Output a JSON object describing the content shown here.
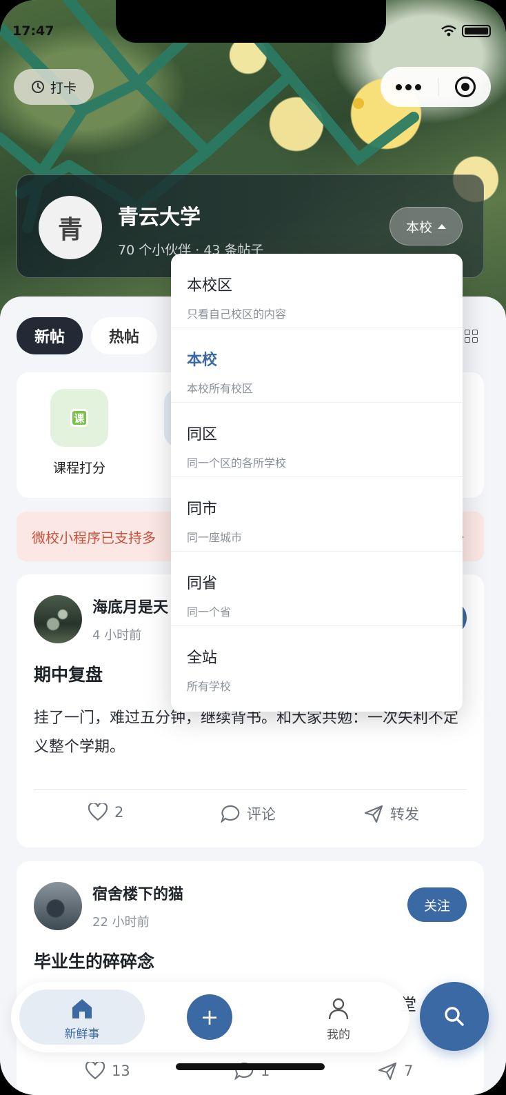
{
  "status_bar": {
    "time": "17:47"
  },
  "header": {
    "checkin_label": "打卡",
    "school": {
      "avatar_char": "青",
      "name": "青云大学",
      "stats": "70 个小伙伴 · 43 条帖子",
      "scope_button": "本校"
    }
  },
  "tabs": [
    {
      "label": "新帖",
      "active": true
    },
    {
      "label": "热帖",
      "active": false
    }
  ],
  "tools": [
    {
      "label": "课程打分",
      "icon_char": "课"
    }
  ],
  "notice": {
    "text": "微校小程序已支持多",
    "arrow": "›"
  },
  "posts": [
    {
      "user": "海底月是天",
      "time": "4 小时前",
      "follow": "关注",
      "title": "期中复盘",
      "body": "挂了一门，难过五分钟，继续背书。和大家共勉：一次失利不定义整个学期。",
      "likes": "2",
      "comment": "评论",
      "share": "转发"
    },
    {
      "user": "宿舍楼下的猫",
      "time": "22 小时前",
      "follow": "关注",
      "title": "毕业生的碎碎念",
      "body_tail": "堂",
      "likes": "13",
      "comments": "1",
      "shares": "7"
    }
  ],
  "scope_dropdown": {
    "selected": "本校",
    "options": [
      {
        "title": "本校区",
        "desc": "只看自己校区的内容"
      },
      {
        "title": "本校",
        "desc": "本校所有校区"
      },
      {
        "title": "同区",
        "desc": "同一个区的各所学校"
      },
      {
        "title": "同市",
        "desc": "同一座城市"
      },
      {
        "title": "同省",
        "desc": "同一个省"
      },
      {
        "title": "全站",
        "desc": "所有学校"
      }
    ]
  },
  "tabbar": {
    "home_label": "新鲜事",
    "plus_label": "+",
    "me_label": "我的"
  },
  "colors": {
    "accent": "#3b69a3",
    "dark_tab": "#232a36",
    "notice_text": "#c9533d",
    "notice_bg": "#fbe7e4"
  }
}
